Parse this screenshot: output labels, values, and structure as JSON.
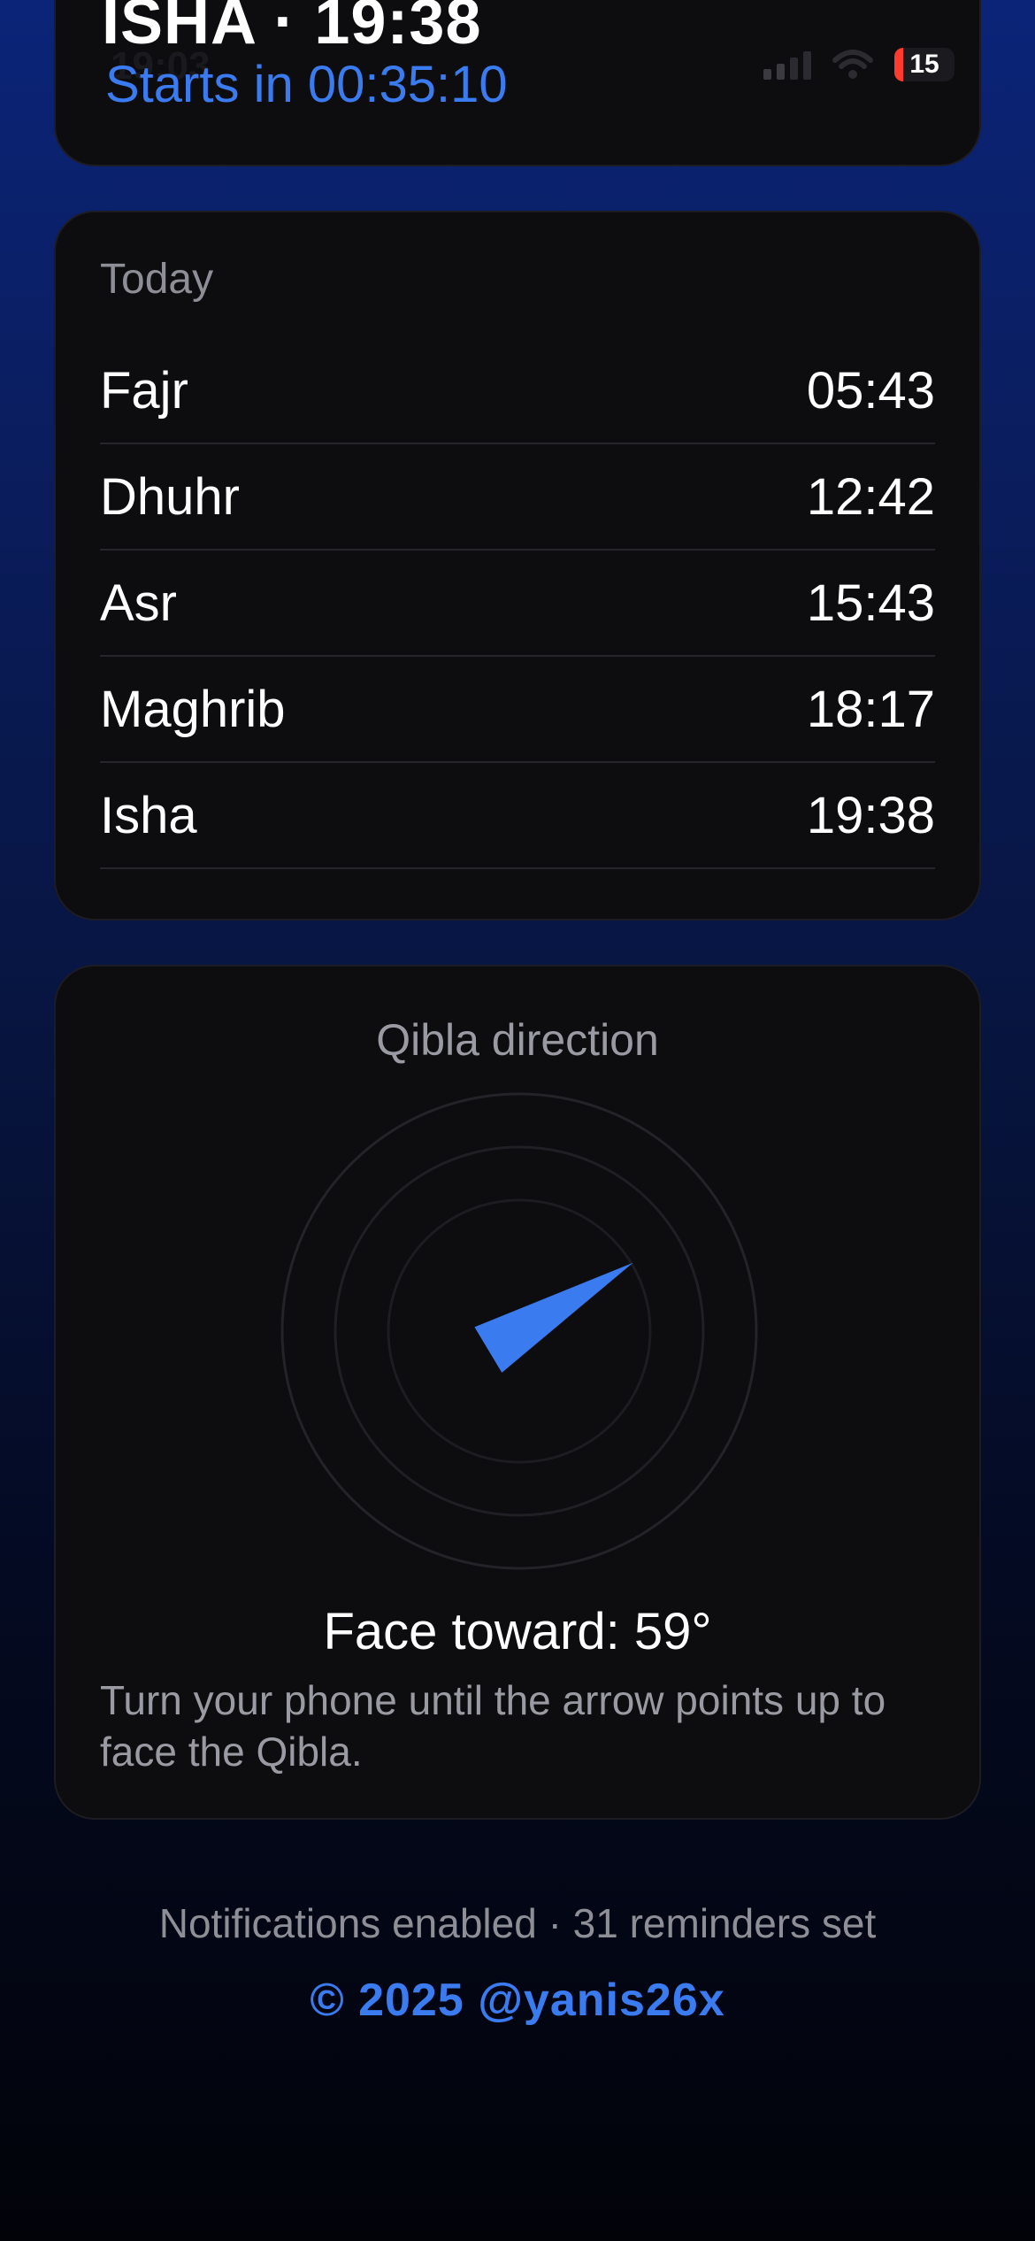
{
  "next_prayer": {
    "title": "ISHA · 19:38",
    "status_time": "19:03",
    "countdown": "Starts in 00:35:10",
    "battery": "15"
  },
  "today": {
    "label": "Today",
    "prayers": [
      {
        "name": "Fajr",
        "time": "05:43"
      },
      {
        "name": "Dhuhr",
        "time": "12:42"
      },
      {
        "name": "Asr",
        "time": "15:43"
      },
      {
        "name": "Maghrib",
        "time": "18:17"
      },
      {
        "name": "Isha",
        "time": "19:38"
      }
    ]
  },
  "qibla": {
    "label": "Qibla direction",
    "heading_deg": 59,
    "face_text": "Face toward: 59°",
    "hint": "Turn your phone until the arrow points up to face the Qibla.",
    "arrow_color": "#3a7bf0"
  },
  "footer": {
    "notifications": "Notifications enabled · 31 reminders set",
    "copyright": "© 2025 @yanis26x"
  },
  "colors": {
    "accent": "#3a7bf0",
    "card": "#0d0d10",
    "muted": "#8e8e96"
  }
}
